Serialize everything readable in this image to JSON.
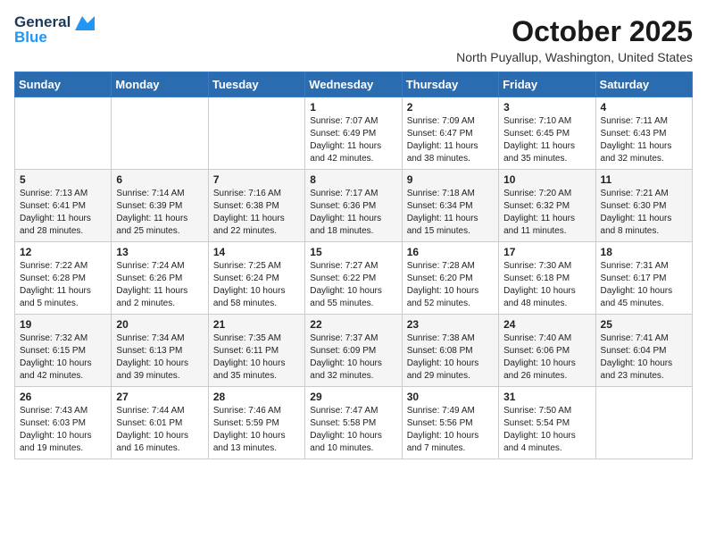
{
  "logo": {
    "line1": "General",
    "line2": "Blue"
  },
  "title": "October 2025",
  "subtitle": "North Puyallup, Washington, United States",
  "headers": [
    "Sunday",
    "Monday",
    "Tuesday",
    "Wednesday",
    "Thursday",
    "Friday",
    "Saturday"
  ],
  "weeks": [
    [
      {
        "day": "",
        "info": ""
      },
      {
        "day": "",
        "info": ""
      },
      {
        "day": "",
        "info": ""
      },
      {
        "day": "1",
        "info": "Sunrise: 7:07 AM\nSunset: 6:49 PM\nDaylight: 11 hours\nand 42 minutes."
      },
      {
        "day": "2",
        "info": "Sunrise: 7:09 AM\nSunset: 6:47 PM\nDaylight: 11 hours\nand 38 minutes."
      },
      {
        "day": "3",
        "info": "Sunrise: 7:10 AM\nSunset: 6:45 PM\nDaylight: 11 hours\nand 35 minutes."
      },
      {
        "day": "4",
        "info": "Sunrise: 7:11 AM\nSunset: 6:43 PM\nDaylight: 11 hours\nand 32 minutes."
      }
    ],
    [
      {
        "day": "5",
        "info": "Sunrise: 7:13 AM\nSunset: 6:41 PM\nDaylight: 11 hours\nand 28 minutes."
      },
      {
        "day": "6",
        "info": "Sunrise: 7:14 AM\nSunset: 6:39 PM\nDaylight: 11 hours\nand 25 minutes."
      },
      {
        "day": "7",
        "info": "Sunrise: 7:16 AM\nSunset: 6:38 PM\nDaylight: 11 hours\nand 22 minutes."
      },
      {
        "day": "8",
        "info": "Sunrise: 7:17 AM\nSunset: 6:36 PM\nDaylight: 11 hours\nand 18 minutes."
      },
      {
        "day": "9",
        "info": "Sunrise: 7:18 AM\nSunset: 6:34 PM\nDaylight: 11 hours\nand 15 minutes."
      },
      {
        "day": "10",
        "info": "Sunrise: 7:20 AM\nSunset: 6:32 PM\nDaylight: 11 hours\nand 11 minutes."
      },
      {
        "day": "11",
        "info": "Sunrise: 7:21 AM\nSunset: 6:30 PM\nDaylight: 11 hours\nand 8 minutes."
      }
    ],
    [
      {
        "day": "12",
        "info": "Sunrise: 7:22 AM\nSunset: 6:28 PM\nDaylight: 11 hours\nand 5 minutes."
      },
      {
        "day": "13",
        "info": "Sunrise: 7:24 AM\nSunset: 6:26 PM\nDaylight: 11 hours\nand 2 minutes."
      },
      {
        "day": "14",
        "info": "Sunrise: 7:25 AM\nSunset: 6:24 PM\nDaylight: 10 hours\nand 58 minutes."
      },
      {
        "day": "15",
        "info": "Sunrise: 7:27 AM\nSunset: 6:22 PM\nDaylight: 10 hours\nand 55 minutes."
      },
      {
        "day": "16",
        "info": "Sunrise: 7:28 AM\nSunset: 6:20 PM\nDaylight: 10 hours\nand 52 minutes."
      },
      {
        "day": "17",
        "info": "Sunrise: 7:30 AM\nSunset: 6:18 PM\nDaylight: 10 hours\nand 48 minutes."
      },
      {
        "day": "18",
        "info": "Sunrise: 7:31 AM\nSunset: 6:17 PM\nDaylight: 10 hours\nand 45 minutes."
      }
    ],
    [
      {
        "day": "19",
        "info": "Sunrise: 7:32 AM\nSunset: 6:15 PM\nDaylight: 10 hours\nand 42 minutes."
      },
      {
        "day": "20",
        "info": "Sunrise: 7:34 AM\nSunset: 6:13 PM\nDaylight: 10 hours\nand 39 minutes."
      },
      {
        "day": "21",
        "info": "Sunrise: 7:35 AM\nSunset: 6:11 PM\nDaylight: 10 hours\nand 35 minutes."
      },
      {
        "day": "22",
        "info": "Sunrise: 7:37 AM\nSunset: 6:09 PM\nDaylight: 10 hours\nand 32 minutes."
      },
      {
        "day": "23",
        "info": "Sunrise: 7:38 AM\nSunset: 6:08 PM\nDaylight: 10 hours\nand 29 minutes."
      },
      {
        "day": "24",
        "info": "Sunrise: 7:40 AM\nSunset: 6:06 PM\nDaylight: 10 hours\nand 26 minutes."
      },
      {
        "day": "25",
        "info": "Sunrise: 7:41 AM\nSunset: 6:04 PM\nDaylight: 10 hours\nand 23 minutes."
      }
    ],
    [
      {
        "day": "26",
        "info": "Sunrise: 7:43 AM\nSunset: 6:03 PM\nDaylight: 10 hours\nand 19 minutes."
      },
      {
        "day": "27",
        "info": "Sunrise: 7:44 AM\nSunset: 6:01 PM\nDaylight: 10 hours\nand 16 minutes."
      },
      {
        "day": "28",
        "info": "Sunrise: 7:46 AM\nSunset: 5:59 PM\nDaylight: 10 hours\nand 13 minutes."
      },
      {
        "day": "29",
        "info": "Sunrise: 7:47 AM\nSunset: 5:58 PM\nDaylight: 10 hours\nand 10 minutes."
      },
      {
        "day": "30",
        "info": "Sunrise: 7:49 AM\nSunset: 5:56 PM\nDaylight: 10 hours\nand 7 minutes."
      },
      {
        "day": "31",
        "info": "Sunrise: 7:50 AM\nSunset: 5:54 PM\nDaylight: 10 hours\nand 4 minutes."
      },
      {
        "day": "",
        "info": ""
      }
    ]
  ]
}
